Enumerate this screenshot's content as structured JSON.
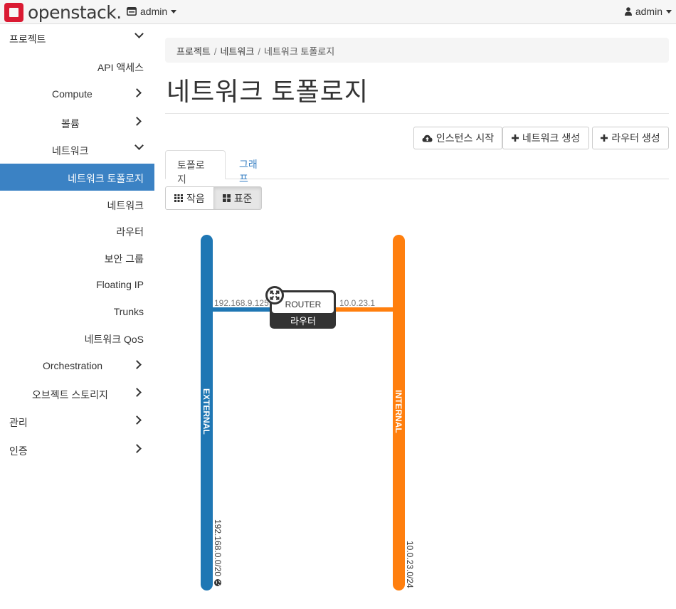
{
  "brand": {
    "name": "openstack",
    "dot": "."
  },
  "header": {
    "project_label": "admin",
    "user_label": "admin"
  },
  "sidebar": {
    "items": [
      {
        "label": "프로젝트"
      },
      {
        "label": "API 액세스"
      },
      {
        "label": "Compute"
      },
      {
        "label": "볼륨"
      },
      {
        "label": "네트워크"
      },
      {
        "label": "네트워크 토폴로지"
      },
      {
        "label": "네트워크"
      },
      {
        "label": "라우터"
      },
      {
        "label": "보안 그룹"
      },
      {
        "label": "Floating IP"
      },
      {
        "label": "Trunks"
      },
      {
        "label": "네트워크 QoS"
      },
      {
        "label": "Orchestration"
      },
      {
        "label": "오브젝트 스토리지"
      },
      {
        "label": "관리"
      },
      {
        "label": "인증"
      }
    ]
  },
  "breadcrumb": {
    "items": [
      "프로젝트",
      "네트워크",
      "네트워크 토폴로지"
    ]
  },
  "page_title": "네트워크 토폴로지",
  "actions": {
    "launch": "인스턴스 시작",
    "create_network": "네트워크 생성",
    "create_router": "라우터 생성"
  },
  "tabs": {
    "topology": "토폴로지",
    "graph": "그래프"
  },
  "view_toggle": {
    "small": "작음",
    "normal": "표준"
  },
  "topology": {
    "networks": [
      {
        "name": "EXTERNAL",
        "cidr": "192.168.0.0/20",
        "color": "#1f77b4"
      },
      {
        "name": "INTERNAL",
        "cidr": "10.0.23.0/24",
        "color": "#ff7f0e"
      }
    ],
    "router": {
      "type": "ROUTER",
      "name": "라우터",
      "ip_external": "192.168.9.125",
      "ip_internal": "10.0.23.1"
    }
  },
  "colors": {
    "accent": "#3b82c4",
    "external": "#1f77b4",
    "internal": "#ff7f0e",
    "logo": "#da1a32"
  }
}
